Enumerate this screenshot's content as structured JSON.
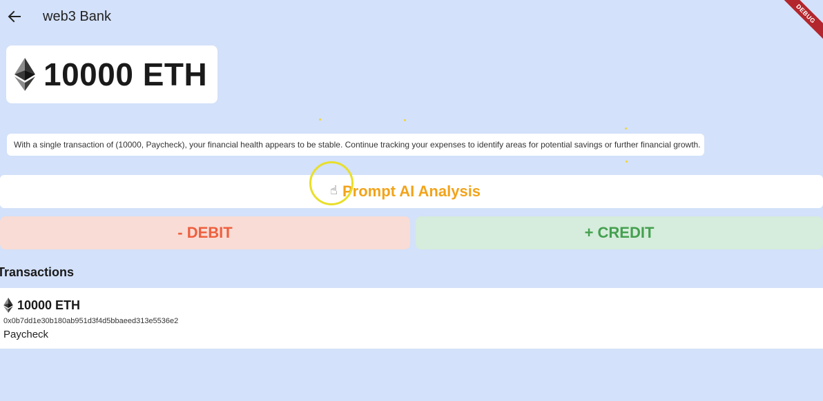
{
  "app_bar": {
    "title": "web3 Bank",
    "back_icon": "arrow-left-icon",
    "debug_banner": "DEBUG"
  },
  "balance": {
    "icon": "ethereum-icon",
    "amount": "10000 ETH"
  },
  "analysis": {
    "text": "With a single transaction of (10000, Paycheck), your financial health appears to be stable. Continue tracking your expenses to identify areas for potential savings or further financial growth."
  },
  "actions": {
    "prompt_label": "Prompt AI Analysis",
    "debit_label": "- DEBIT",
    "credit_label": "+ CREDIT"
  },
  "transactions": {
    "title": "Transactions",
    "items": [
      {
        "amount": "10000 ETH",
        "hash": "0x0b7dd1e30b180ab951d3f4d5bbaeed313e5536e2",
        "note": "Paycheck"
      }
    ]
  },
  "colors": {
    "background": "#d3e1fa",
    "prompt": "#f2a31a",
    "debit": "#ef5f3e",
    "debit_bg": "#f8dcd5",
    "credit": "#44a04f",
    "credit_bg": "#d6ecdc"
  }
}
